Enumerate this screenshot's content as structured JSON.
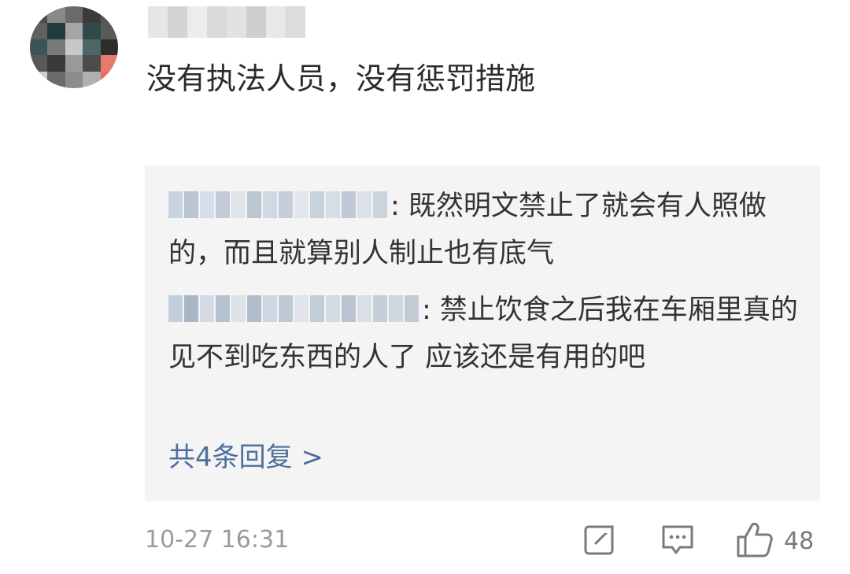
{
  "comment": {
    "text": "没有执法人员，没有惩罚措施",
    "timestamp": "10-27 16:31",
    "like_count": "48",
    "icons": {
      "avatar": "avatar",
      "share": "share-icon",
      "reply": "comment-icon",
      "like": "thumbs-up-icon"
    }
  },
  "replies": [
    {
      "separator": ":",
      "text": " 既然明文禁止了就会有人照做的，而且就算别人制止也有底气"
    },
    {
      "separator": ":",
      "text": " 禁止饮食之后我在车厢里真的见不到吃东西的人了 应该还是有用的吧"
    }
  ],
  "more_replies": "共4条回复 >",
  "colors": {
    "link": "#4d6f9c",
    "reply_background": "#f4f4f4",
    "meta_text": "#9a9a9a"
  }
}
